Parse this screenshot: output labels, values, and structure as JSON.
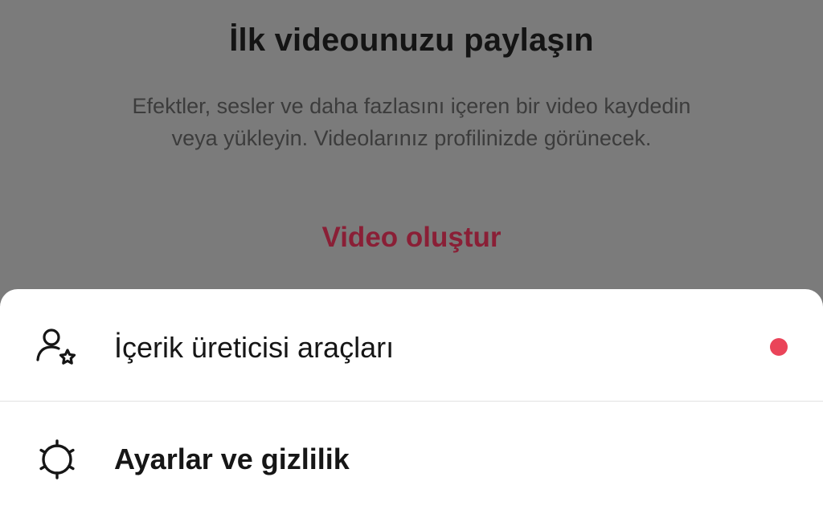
{
  "empty_state": {
    "title": "İlk videounuzu paylaşın",
    "description": "Efektler, sesler ve daha fazlasını içeren bir video kaydedin veya yükleyin. Videolarınız profilinizde görünecek.",
    "create_link": "Video oluştur"
  },
  "menu": {
    "items": [
      {
        "label": "İçerik üreticisi araçları",
        "icon": "creator-tools-icon",
        "has_notification_dot": true
      },
      {
        "label": "Ayarlar ve gizlilik",
        "icon": "gear-icon",
        "has_notification_dot": false
      }
    ]
  },
  "colors": {
    "accent": "#ea4459",
    "link": "#8a1f36",
    "overlay": "#7b7b7b",
    "sheet": "#ffffff"
  }
}
